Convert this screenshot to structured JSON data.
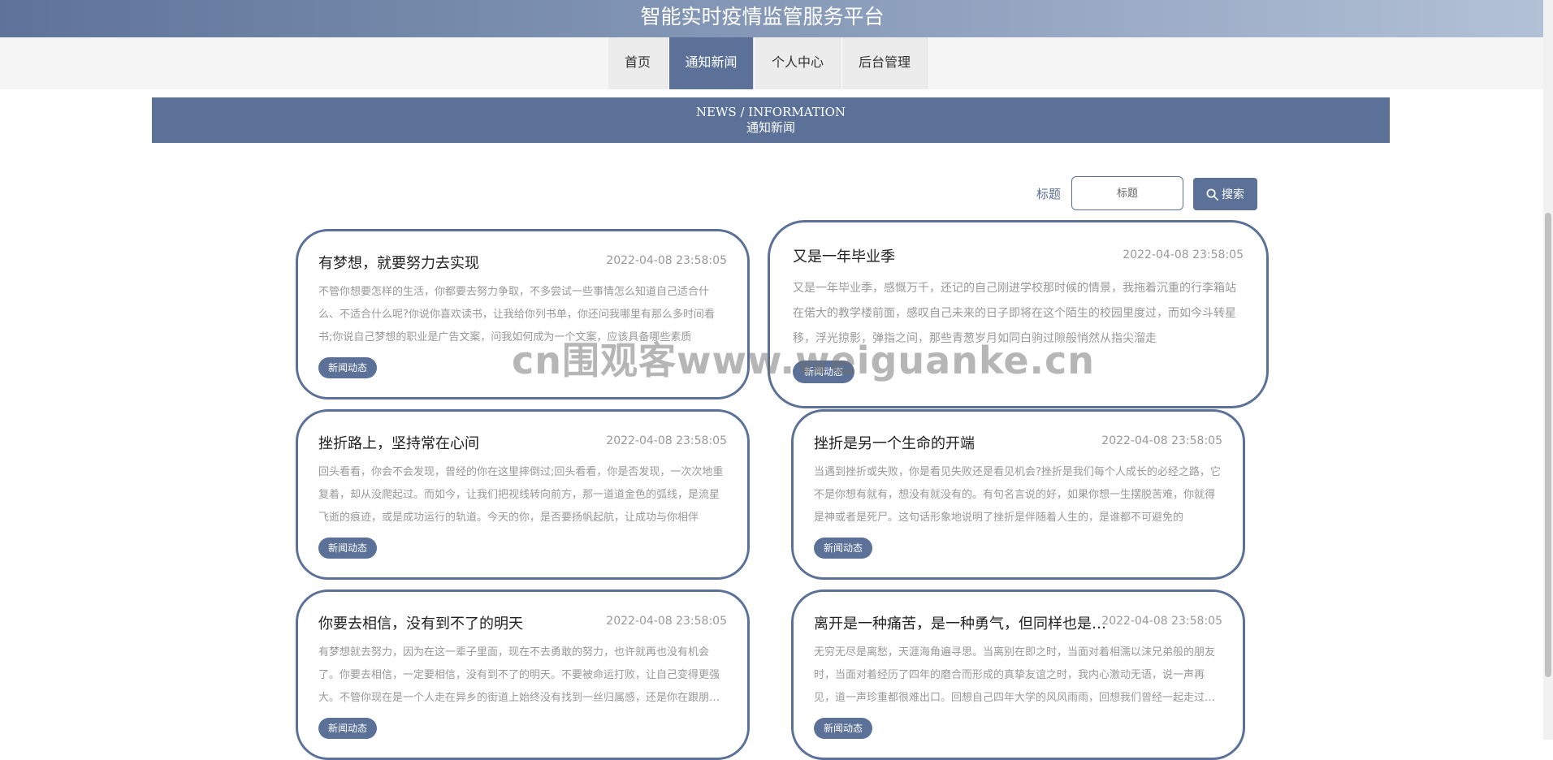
{
  "site": {
    "title": "智能实时疫情监管服务平台"
  },
  "nav": {
    "items": [
      {
        "label": "首页"
      },
      {
        "label": "通知新闻",
        "active": true
      },
      {
        "label": "个人中心"
      },
      {
        "label": "后台管理"
      }
    ]
  },
  "banner": {
    "en": "NEWS / INFORMATION",
    "cn": "通知新闻"
  },
  "search": {
    "label": "标题",
    "placeholder": "标题",
    "button_label": "搜索",
    "button_icon": "search-icon"
  },
  "news": [
    {
      "title": "有梦想，就要努力去实现",
      "date": "2022-04-08 23:58:05",
      "summary": "不管你想要怎样的生活，你都要去努力争取，不多尝试一些事情怎么知道自己适合什么、不适合什么呢?你说你喜欢读书，让我给你列书单，你还问我哪里有那么多时间看书;你说自己梦想的职业是广告文案，问我如何成为一个文案，应该具备哪些素质",
      "tag": "新闻动态"
    },
    {
      "title": "又是一年毕业季",
      "date": "2022-04-08 23:58:05",
      "summary": "又是一年毕业季，感慨万千，还记的自己刚进学校那时候的情景，我拖着沉重的行李箱站在偌大的教学楼前面，感叹自己未来的日子即将在这个陌生的校园里度过，而如今斗转星移，浮光掠影，弹指之间，那些青葱岁月如同白驹过隙般悄然从指尖溜走",
      "tag": "新闻动态"
    },
    {
      "title": "挫折路上，坚持常在心间",
      "date": "2022-04-08 23:58:05",
      "summary": "回头看看，你会不会发现，曾经的你在这里摔倒过;回头看看，你是否发现，一次次地重复着，却从没爬起过。而如今，让我们把视线转向前方，那一道道金色的弧线，是流星飞逝的痕迹，或是成功运行的轨道。今天的你，是否要扬帆起航，让成功与你相伴",
      "tag": "新闻动态"
    },
    {
      "title": "挫折是另一个生命的开端",
      "date": "2022-04-08 23:58:05",
      "summary": "当遇到挫折或失败，你是看见失败还是看见机会?挫折是我们每个人成长的必经之路，它不是你想有就有，想没有就没有的。有句名言说的好，如果你想一生摆脱苦难，你就得是神或者是死尸。这句话形象地说明了挫折是伴随着人生的，是谁都不可避免的",
      "tag": "新闻动态"
    },
    {
      "title": "你要去相信，没有到不了的明天",
      "date": "2022-04-08 23:58:05",
      "summary": "有梦想就去努力，因为在这一辈子里面，现在不去勇敢的努力，也许就再也没有机会了。你要去相信，一定要相信，没有到不了的明天。不要被命运打败，让自己变得更强大。不管你现在是一个人走在异乡的街道上始终没有找到一丝归属感，还是你在跟朋友一起",
      "tag": "新闻动态"
    },
    {
      "title": "离开是一种痛苦，是一种勇气，但同样也是一个考验",
      "date": "2022-04-08 23:58:05",
      "summary": "无穷无尽是离愁，天涯海角遍寻思。当离别在即之时，当面对着相濡以沫兄弟般的朋友时，当面对着经历了四年的磨合而形成的真挚友谊之时，我内心激动无语，说一声再见，道一声珍重都很难出口。回想自己四年大学的风风雨雨，回想我们曾经一起走过的日子",
      "tag": "新闻动态"
    }
  ],
  "watermark": "cn围观客www.weiguanke.cn"
}
